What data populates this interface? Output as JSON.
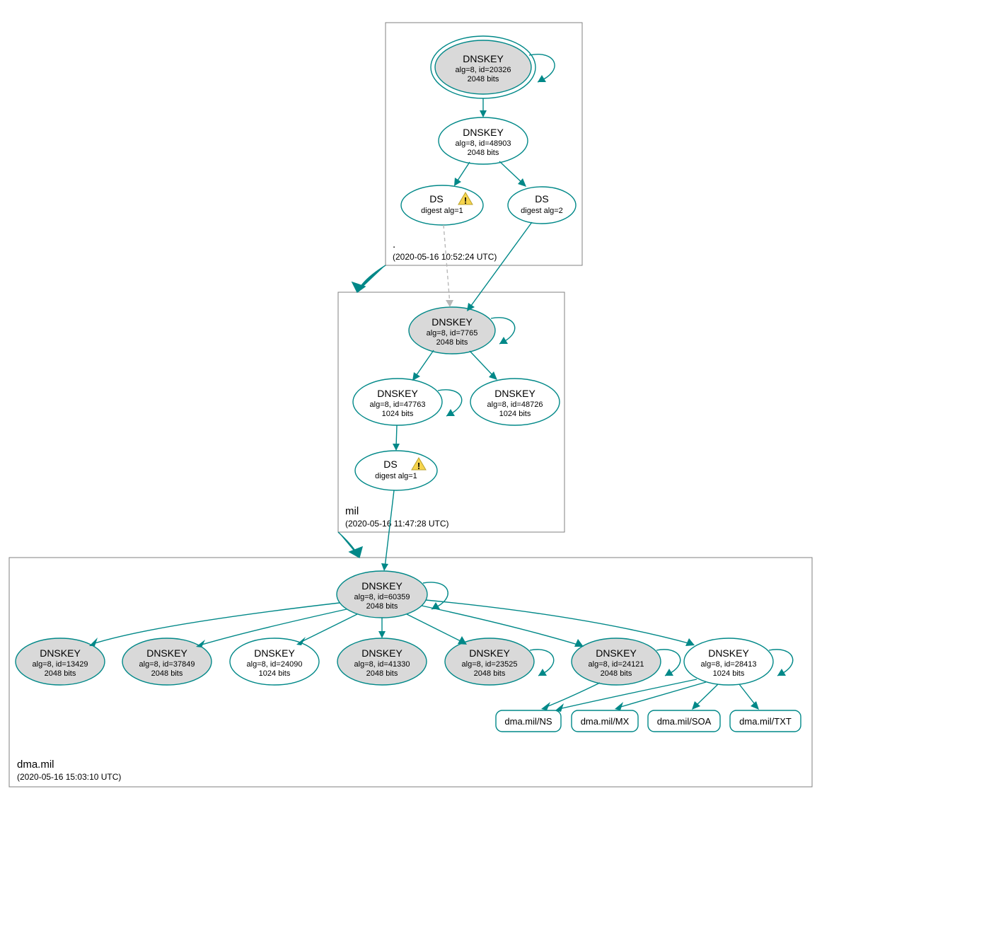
{
  "zones": {
    "root": {
      "label": ".",
      "timestamp": "(2020-05-16 10:52:24 UTC)"
    },
    "mil": {
      "label": "mil",
      "timestamp": "(2020-05-16 11:47:28 UTC)"
    },
    "dma": {
      "label": "dma.mil",
      "timestamp": "(2020-05-16 15:03:10 UTC)"
    }
  },
  "nodes": {
    "root_ksk": {
      "title": "DNSKEY",
      "l2": "alg=8, id=20326",
      "l3": "2048 bits"
    },
    "root_zsk": {
      "title": "DNSKEY",
      "l2": "alg=8, id=48903",
      "l3": "2048 bits"
    },
    "root_ds1": {
      "title": "DS",
      "l2": "digest alg=1",
      "warn": true
    },
    "root_ds2": {
      "title": "DS",
      "l2": "digest alg=2"
    },
    "mil_ksk": {
      "title": "DNSKEY",
      "l2": "alg=8, id=7765",
      "l3": "2048 bits"
    },
    "mil_zsk1": {
      "title": "DNSKEY",
      "l2": "alg=8, id=47763",
      "l3": "1024 bits"
    },
    "mil_zsk2": {
      "title": "DNSKEY",
      "l2": "alg=8, id=48726",
      "l3": "1024 bits"
    },
    "mil_ds1": {
      "title": "DS",
      "l2": "digest alg=1",
      "warn": true
    },
    "dma_ksk": {
      "title": "DNSKEY",
      "l2": "alg=8, id=60359",
      "l3": "2048 bits"
    },
    "dma_k1": {
      "title": "DNSKEY",
      "l2": "alg=8, id=13429",
      "l3": "2048 bits"
    },
    "dma_k2": {
      "title": "DNSKEY",
      "l2": "alg=8, id=37849",
      "l3": "2048 bits"
    },
    "dma_k3": {
      "title": "DNSKEY",
      "l2": "alg=8, id=24090",
      "l3": "1024 bits"
    },
    "dma_k4": {
      "title": "DNSKEY",
      "l2": "alg=8, id=41330",
      "l3": "2048 bits"
    },
    "dma_k5": {
      "title": "DNSKEY",
      "l2": "alg=8, id=23525",
      "l3": "2048 bits"
    },
    "dma_k6": {
      "title": "DNSKEY",
      "l2": "alg=8, id=24121",
      "l3": "2048 bits"
    },
    "dma_k7": {
      "title": "DNSKEY",
      "l2": "alg=8, id=28413",
      "l3": "1024 bits"
    }
  },
  "rrsets": {
    "ns": "dma.mil/NS",
    "mx": "dma.mil/MX",
    "soa": "dma.mil/SOA",
    "txt": "dma.mil/TXT"
  }
}
